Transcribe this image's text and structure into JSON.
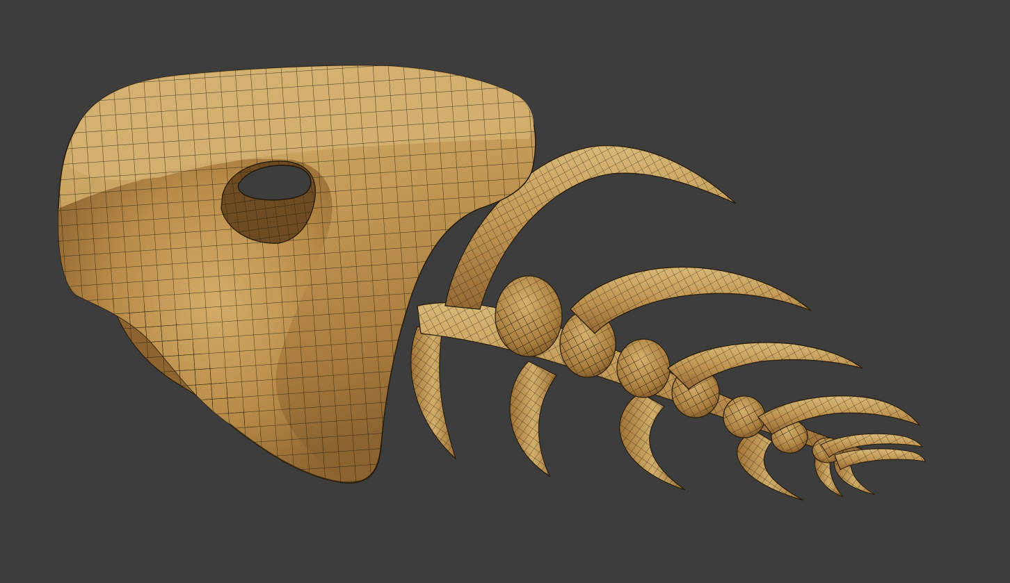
{
  "scene": {
    "subject": "fish-skeleton-mesh",
    "colors": {
      "background": "#3d3d3d",
      "mesh_light": "#d2b06c",
      "mesh_mid": "#b48a4a",
      "mesh_dark": "#7a5526",
      "wireframe": "#1e1608",
      "hole": "#3d3d3d"
    }
  }
}
